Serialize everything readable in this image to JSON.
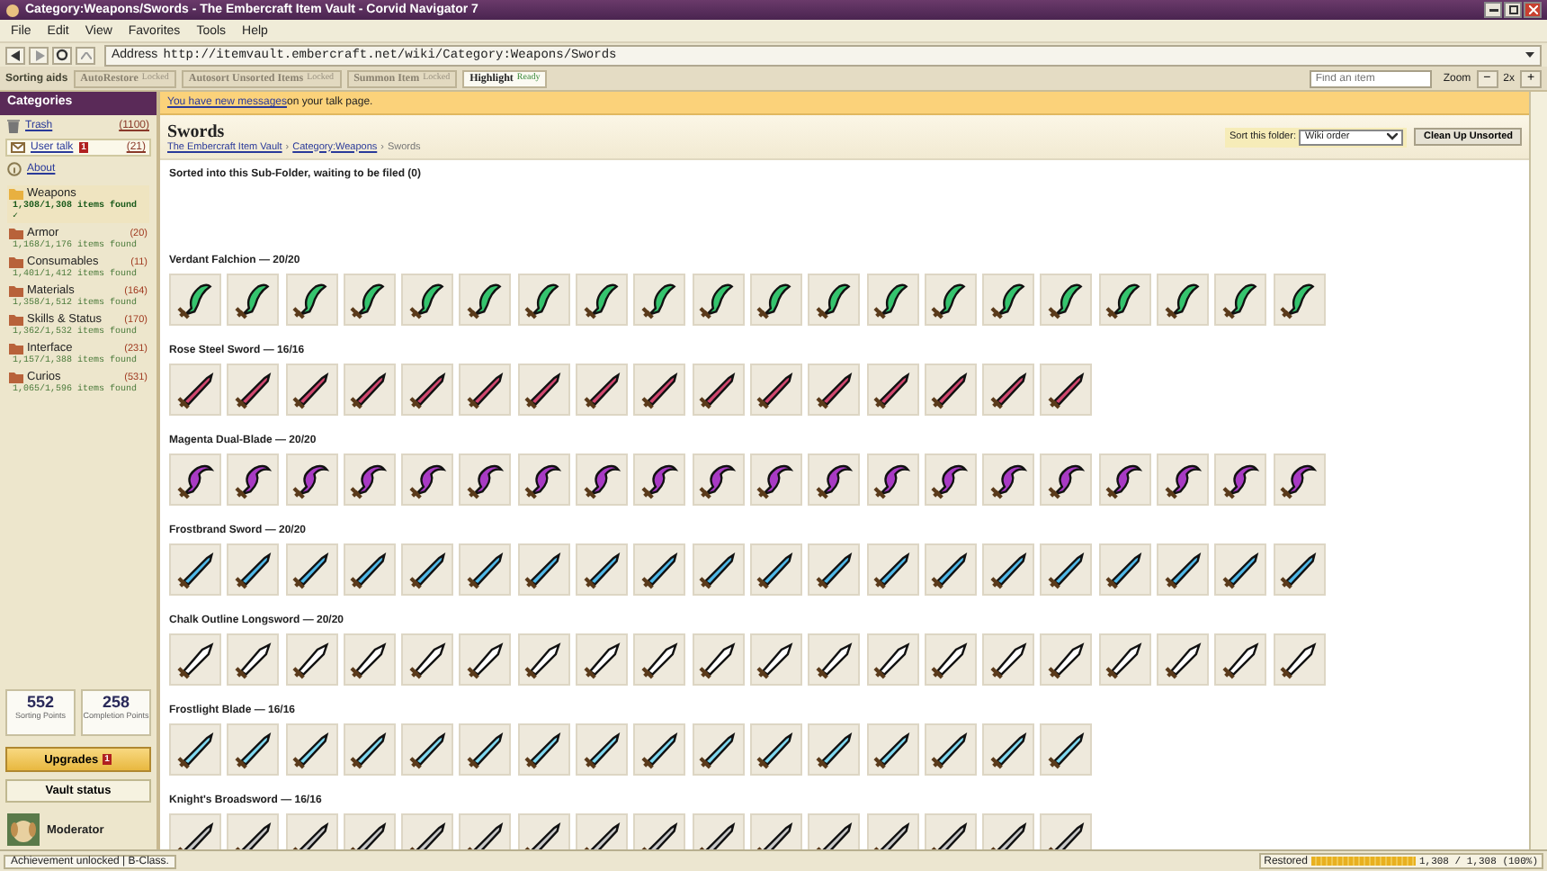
{
  "window": {
    "title": "Category:Weapons/Swords - The Embercraft Item Vault - Corvid Navigator 7"
  },
  "menu": [
    "File",
    "Edit",
    "View",
    "Favorites",
    "Tools",
    "Help"
  ],
  "address": {
    "label": "Address",
    "value": "http://itemvault.embercraft.net/wiki/Category:Weapons/Swords"
  },
  "toolbar": {
    "label": "Sorting aids",
    "aids": [
      {
        "name": "AutoRestore",
        "state": "Locked",
        "enabled": false
      },
      {
        "name": "Autosort Unsorted Items",
        "state": "Locked",
        "enabled": false
      },
      {
        "name": "Summon Item",
        "state": "Locked",
        "enabled": false
      },
      {
        "name": "Highlight",
        "state": "Ready",
        "enabled": true
      }
    ],
    "search": {
      "placeholder": "Find an item"
    },
    "zoom": {
      "label": "Zoom",
      "minus": "−",
      "value": "2x",
      "plus": "+"
    }
  },
  "sidebar": {
    "title": "Categories",
    "links": [
      {
        "kind": "trash",
        "label": "Trash",
        "count": "(1100)"
      },
      {
        "kind": "talk",
        "label": "User talk",
        "count": "(21)",
        "badge": "1"
      },
      {
        "kind": "about",
        "label": "About"
      }
    ],
    "folders": [
      {
        "name": "Weapons",
        "found": "1,308/1,308 items found ✓",
        "selected": true
      },
      {
        "name": "Armor",
        "count": "(20)",
        "found": "1,168/1,176 items found",
        "selected": false
      },
      {
        "name": "Consumables",
        "count": "(11)",
        "found": "1,401/1,412 items found",
        "selected": false
      },
      {
        "name": "Materials",
        "count": "(164)",
        "found": "1,358/1,512 items found",
        "selected": false
      },
      {
        "name": "Skills & Status",
        "count": "(170)",
        "found": "1,362/1,532 items found",
        "selected": false
      },
      {
        "name": "Interface",
        "count": "(231)",
        "found": "1,157/1,388 items found",
        "selected": false
      },
      {
        "name": "Curios",
        "count": "(531)",
        "found": "1,065/1,596 items found",
        "selected": false
      }
    ],
    "stats": [
      {
        "value": "552",
        "label": "Sorting Points"
      },
      {
        "value": "258",
        "label": "Completion Points"
      }
    ],
    "upgrades": {
      "label": "Upgrades",
      "badge": "1"
    },
    "vault": "Vault status",
    "user": "Moderator"
  },
  "notice": {
    "link": "You have new messages",
    "rest": " on your talk page."
  },
  "page": {
    "title": "Swords",
    "breadcrumb": [
      "The Embercraft Item Vault",
      "Category:Weapons",
      "Swords"
    ],
    "separator": "›",
    "sort_label": "Sort this folder:",
    "sort_value": "Wiki order",
    "cleanup": "Clean Up Unsorted",
    "pending": "Sorted into this Sub-Folder, waiting to be filed (0)"
  },
  "groups": [
    {
      "title": "Verdant Falchion — 20/20",
      "kind": "curved",
      "color": "#35c46e",
      "tiles": [
        {
          "found": true
        },
        {
          "found": true
        },
        {
          "found": true
        },
        {
          "found": true
        },
        {
          "found": true
        },
        {
          "found": true
        },
        {
          "found": true
        },
        {
          "found": true
        },
        {
          "found": true
        },
        {
          "found": true
        },
        {
          "found": true
        },
        {
          "found": true
        },
        {
          "found": true
        },
        {
          "found": true
        },
        {
          "found": true
        },
        {
          "found": true
        },
        {
          "found": true
        },
        {
          "found": true
        },
        {
          "found": true
        },
        {
          "found": true
        }
      ]
    },
    {
      "title": "Rose Steel Sword — 16/16",
      "kind": "straight",
      "color": "#d0476f",
      "tiles": [
        {
          "found": true
        },
        {
          "found": true
        },
        {
          "found": true
        },
        {
          "found": true
        },
        {
          "found": true
        },
        {
          "found": true
        },
        {
          "found": true
        },
        {
          "found": true
        },
        {
          "found": true
        },
        {
          "found": true
        },
        {
          "found": true
        },
        {
          "found": true
        },
        {
          "found": true
        },
        {
          "found": true
        },
        {
          "found": true
        },
        {
          "found": true
        }
      ]
    },
    {
      "title": "Magenta Dual-Blade — 20/20",
      "kind": "hooked",
      "color": "#a83ac4",
      "tiles": [
        {
          "found": true
        },
        {
          "found": true
        },
        {
          "found": true
        },
        {
          "found": true
        },
        {
          "found": true
        },
        {
          "found": true
        },
        {
          "found": true
        },
        {
          "found": true
        },
        {
          "found": true
        },
        {
          "found": true
        },
        {
          "found": true
        },
        {
          "found": true
        },
        {
          "found": true
        },
        {
          "found": true
        },
        {
          "found": true
        },
        {
          "found": true
        },
        {
          "found": true
        },
        {
          "found": true
        },
        {
          "found": true
        },
        {
          "found": true
        }
      ]
    },
    {
      "title": "Frostbrand Sword — 20/20",
      "kind": "straight",
      "color": "#4fb8e8",
      "tiles": [
        {
          "found": true
        },
        {
          "found": true
        },
        {
          "found": true
        },
        {
          "found": true
        },
        {
          "found": true
        },
        {
          "found": true
        },
        {
          "found": true
        },
        {
          "found": true
        },
        {
          "found": true
        },
        {
          "found": true
        },
        {
          "found": true
        },
        {
          "found": true
        },
        {
          "found": true
        },
        {
          "found": true
        },
        {
          "found": true
        },
        {
          "found": true
        },
        {
          "found": true
        },
        {
          "found": true
        },
        {
          "found": true
        },
        {
          "found": true
        }
      ]
    },
    {
      "title": "Chalk Outline Longsword — 20/20",
      "kind": "outline",
      "color": "#ffffff",
      "tiles": [
        {
          "found": true
        },
        {
          "found": true
        },
        {
          "found": true
        },
        {
          "found": true
        },
        {
          "found": true
        },
        {
          "found": true
        },
        {
          "found": true
        },
        {
          "found": true
        },
        {
          "found": true
        },
        {
          "found": true
        },
        {
          "found": true
        },
        {
          "found": true
        },
        {
          "found": true
        },
        {
          "found": true
        },
        {
          "found": true
        },
        {
          "found": true
        },
        {
          "found": true
        },
        {
          "found": true
        },
        {
          "found": true
        },
        {
          "found": true
        }
      ]
    },
    {
      "title": "Frostlight Blade — 16/16",
      "kind": "straight",
      "color": "#7fd8f0",
      "tiles": [
        {
          "found": true
        },
        {
          "found": true
        },
        {
          "found": true
        },
        {
          "found": true
        },
        {
          "found": true
        },
        {
          "found": true
        },
        {
          "found": true
        },
        {
          "found": true
        },
        {
          "found": true
        },
        {
          "found": true
        },
        {
          "found": true
        },
        {
          "found": true
        },
        {
          "found": true
        },
        {
          "found": true
        },
        {
          "found": true
        },
        {
          "found": true
        }
      ]
    },
    {
      "title": "Knight's Broadsword — 16/16",
      "kind": "straight",
      "color": "#c8c8c8",
      "tiles": [
        {
          "found": true
        },
        {
          "found": true
        },
        {
          "found": true
        },
        {
          "found": true
        },
        {
          "found": true
        },
        {
          "found": true
        },
        {
          "found": true
        },
        {
          "found": true
        },
        {
          "found": true
        },
        {
          "found": true
        },
        {
          "found": true
        },
        {
          "found": true
        },
        {
          "found": true
        },
        {
          "found": true
        },
        {
          "found": true
        },
        {
          "found": true
        }
      ]
    }
  ],
  "status": {
    "message": "Achievement unlocked | B-Class.",
    "progress_label": "Restored",
    "level": 1.0,
    "reading": "1,308 / 1,308 (100%)"
  }
}
